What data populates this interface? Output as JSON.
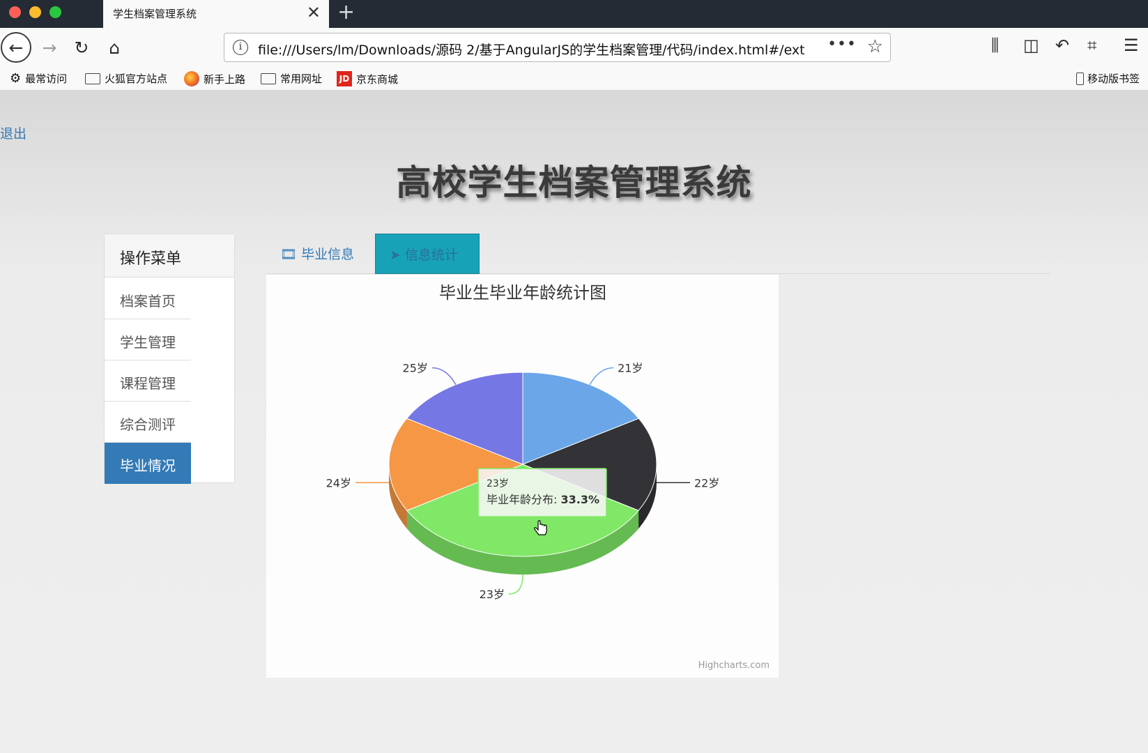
{
  "browser": {
    "tab_title": "学生档案管理系统",
    "url": "file:///Users/lm/Downloads/源码 2/基于AngularJS的学生档案管理/代码/index.html#/ext",
    "bookmarks": [
      {
        "label": "最常访问",
        "icon": "gear-icon"
      },
      {
        "label": "火狐官方站点",
        "icon": "folder-icon"
      },
      {
        "label": "新手上路",
        "icon": "firefox-icon"
      },
      {
        "label": "常用网址",
        "icon": "folder-icon"
      },
      {
        "label": "京东商城",
        "icon": "jd-icon",
        "icon_text": "JD"
      },
      {
        "label": "移动版书签",
        "icon": "phone-icon"
      }
    ]
  },
  "page": {
    "logout_label": "退出",
    "title": "高校学生档案管理系统"
  },
  "menu": {
    "heading": "操作菜单",
    "items": [
      {
        "label": "档案首页",
        "active": false
      },
      {
        "label": "学生管理",
        "active": false
      },
      {
        "label": "课程管理",
        "active": false
      },
      {
        "label": "综合测评",
        "active": false
      },
      {
        "label": "毕业情况",
        "active": true
      }
    ]
  },
  "tabs": [
    {
      "label": "毕业信息",
      "icon": "film-icon",
      "active": false
    },
    {
      "label": "信息统计",
      "icon": "send-icon",
      "active": true
    }
  ],
  "chart_data": {
    "type": "pie",
    "title": "毕业生毕业年龄统计图",
    "series_name": "毕业年龄分布",
    "slices": [
      {
        "label": "21岁",
        "value": 16.7,
        "color": "#6aa6e8"
      },
      {
        "label": "22岁",
        "value": 16.7,
        "color": "#333337"
      },
      {
        "label": "23岁",
        "value": 33.3,
        "color": "#80e866"
      },
      {
        "label": "24岁",
        "value": 16.7,
        "color": "#f59744"
      },
      {
        "label": "25岁",
        "value": 16.7,
        "color": "#7577e5"
      }
    ],
    "tooltip": {
      "category": "23岁",
      "series": "毕业年龄分布",
      "value": "33.3%"
    },
    "credit": "Highcharts.com"
  }
}
